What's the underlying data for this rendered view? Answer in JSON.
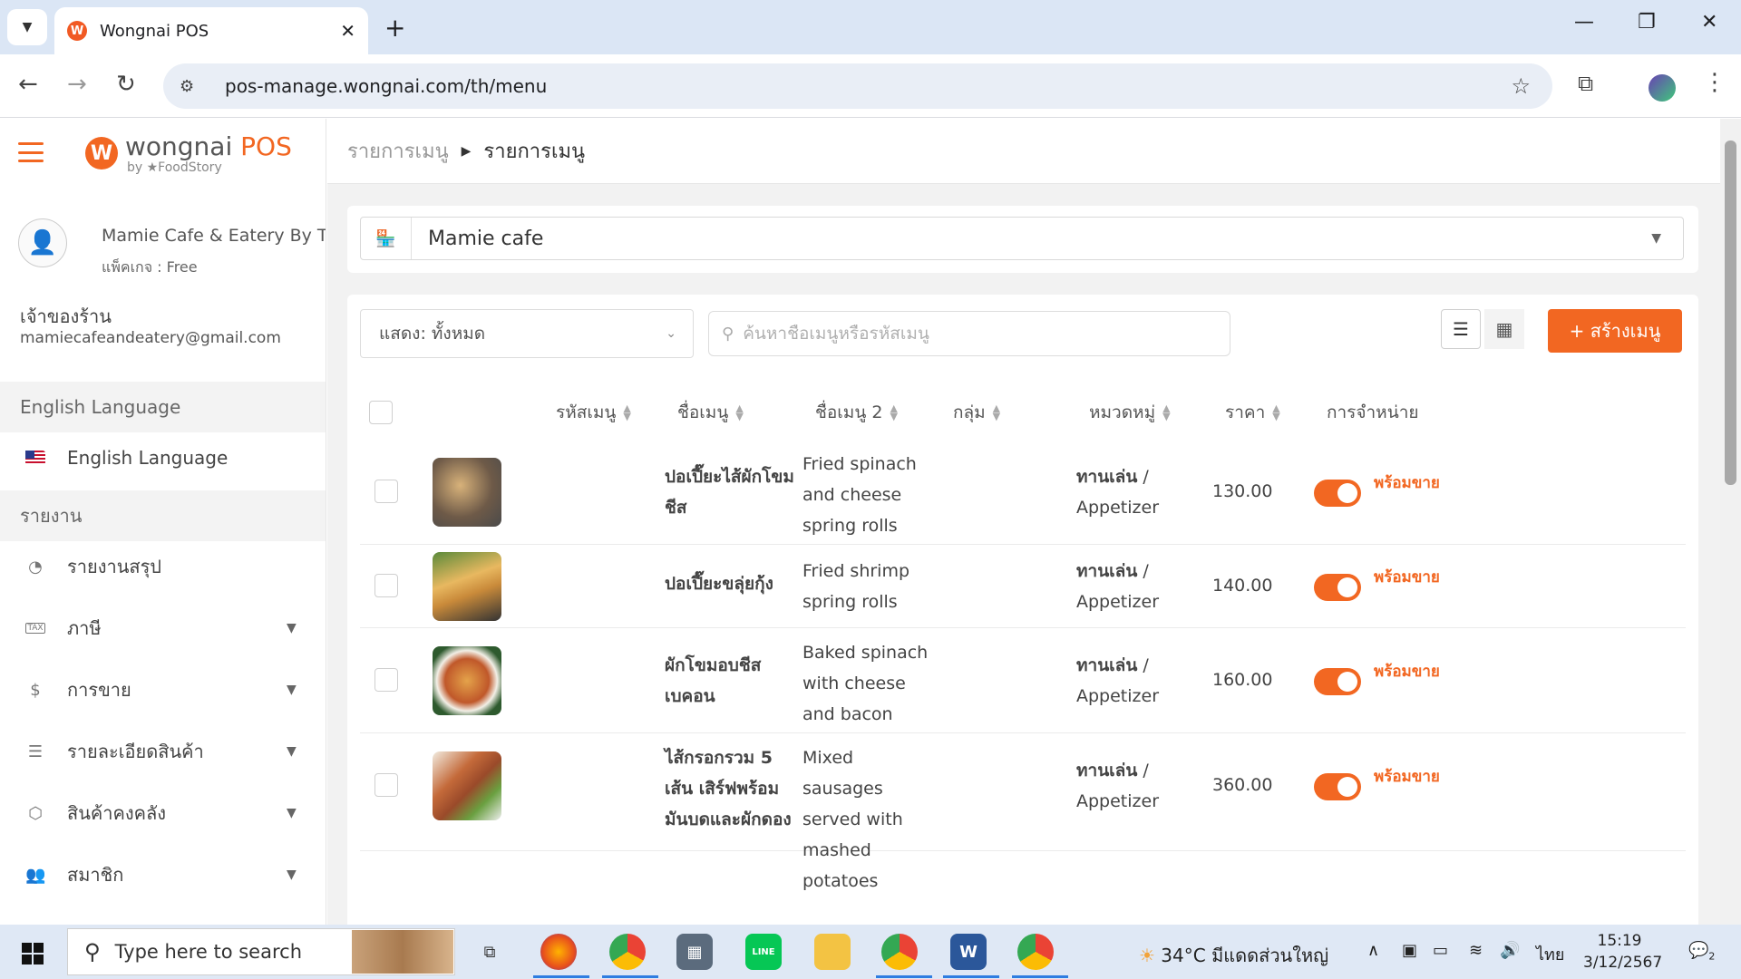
{
  "browser": {
    "tab_title": "Wongnai POS",
    "tab_favicon": "W",
    "url": "pos-manage.wongnai.com/th/menu"
  },
  "sidebar": {
    "logo_mark": "W",
    "logo_name": "wongnai",
    "logo_product": "POS",
    "logo_sub": "by ★FoodStory",
    "shop_name": "Mamie Cafe & Eatery By T",
    "package": "แพ็คเกจ : Free",
    "role": "เจ้าของร้าน",
    "email": "mamiecafeandeatery@gmail.com",
    "language_section": "English Language",
    "language_item": "English Language",
    "report_section": "รายงาน",
    "items": [
      {
        "label": "รายงานสรุป",
        "icon": "pie-chart-icon"
      },
      {
        "label": "ภาษี",
        "icon": "tax-icon"
      },
      {
        "label": "การขาย",
        "icon": "dollar-icon"
      },
      {
        "label": "รายละเอียดสินค้า",
        "icon": "list-icon"
      },
      {
        "label": "สินค้าคงคลัง",
        "icon": "box-icon"
      },
      {
        "label": "สมาชิก",
        "icon": "users-icon"
      }
    ]
  },
  "main": {
    "breadcrumb_parent": "รายการเมนู",
    "breadcrumb_current": "รายการเมนู",
    "branch": "Mamie cafe",
    "filter": "แสดง: ทั้งหมด",
    "search_placeholder": "ค้นหาชื่อเมนูหรือรหัสเมนู",
    "create_label": "+ สร้างเมนู",
    "columns": {
      "code": "รหัสเมนู",
      "name": "ชื่อเมนู",
      "name2": "ชื่อเมนู 2",
      "group": "กลุ่ม",
      "category": "หมวดหมู่",
      "price": "ราคา",
      "sale": "การจำหน่าย"
    },
    "rows": [
      {
        "name": "ปอเปี๊ยะไส้ผักโขมชีส",
        "name2": "Fried spinach and cheese spring rolls",
        "category_th": "ทานเล่น",
        "category_en": "/ Appetizer",
        "price": "130.00",
        "status": "พร้อมขาย"
      },
      {
        "name": "ปอเปี๊ยะขลุ่ยกุ้ง",
        "name2": "Fried shrimp spring rolls",
        "category_th": "ทานเล่น",
        "category_en": "/ Appetizer",
        "price": "140.00",
        "status": "พร้อมขาย"
      },
      {
        "name": "ผักโขมอบชีสเบคอน",
        "name2": "Baked spinach with cheese and bacon",
        "category_th": "ทานเล่น",
        "category_en": "/ Appetizer",
        "price": "160.00",
        "status": "พร้อมขาย"
      },
      {
        "name": "ไส้กรอกรวม 5 เส้น เสิร์ฟพร้อมมันบดและผักดอง",
        "name2": "Mixed sausages served with mashed potatoes",
        "category_th": "ทานเล่น",
        "category_en": "/ Appetizer",
        "price": "360.00",
        "status": "พร้อมขาย"
      }
    ]
  },
  "taskbar": {
    "search": "Type here to search",
    "weather": "34°C  มีแดดส่วนใหญ่",
    "lang": "ไทย",
    "time": "15:19",
    "date": "3/12/2567",
    "notifications": "2"
  },
  "colors": {
    "accent": "#f26722",
    "tabbar": "#dbe6f5",
    "main_bg": "#f2f2f2"
  }
}
